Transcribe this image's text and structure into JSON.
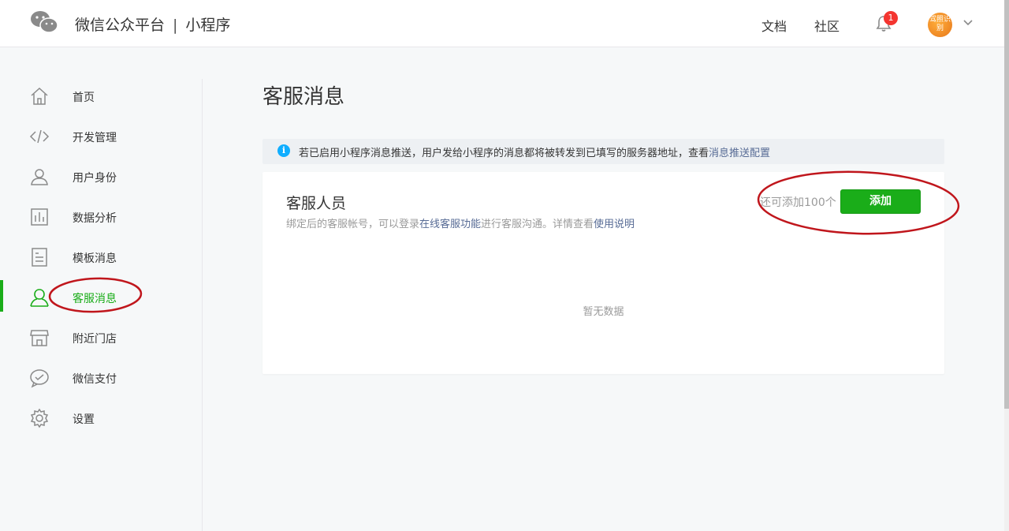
{
  "header": {
    "brand_name": "微信公众平台",
    "separator": "|",
    "product": "小程序",
    "links": [
      "文档",
      "社区"
    ],
    "notification_count": "1",
    "avatar_text": "驾照识别"
  },
  "sidebar": {
    "items": [
      {
        "label": "首页",
        "icon": "home-icon"
      },
      {
        "label": "开发管理",
        "icon": "code-icon"
      },
      {
        "label": "用户身份",
        "icon": "user-icon"
      },
      {
        "label": "数据分析",
        "icon": "bar-chart-icon"
      },
      {
        "label": "模板消息",
        "icon": "document-icon"
      },
      {
        "label": "客服消息",
        "icon": "customer-service-icon",
        "active": true
      },
      {
        "label": "附近门店",
        "icon": "store-icon"
      },
      {
        "label": "微信支付",
        "icon": "payment-icon"
      },
      {
        "label": "设置",
        "icon": "gear-icon"
      }
    ]
  },
  "main": {
    "title": "客服消息",
    "notice": {
      "text": "若已启用小程序消息推送，用户发给小程序的消息都将被转发到已填写的服务器地址，查看",
      "link": "消息推送配置"
    },
    "panel": {
      "title": "客服人员",
      "desc_prefix": "绑定后的客服帐号，可以登录",
      "desc_link1": "在线客服功能",
      "desc_middle": "进行客服沟通。详情查看",
      "desc_link2": "使用说明",
      "quota": "还可添加100个",
      "add_button": "添加",
      "empty_text": "暂无数据"
    }
  },
  "colors": {
    "accent": "#1aad19",
    "link": "#576b95",
    "annotation": "#c0161c"
  }
}
